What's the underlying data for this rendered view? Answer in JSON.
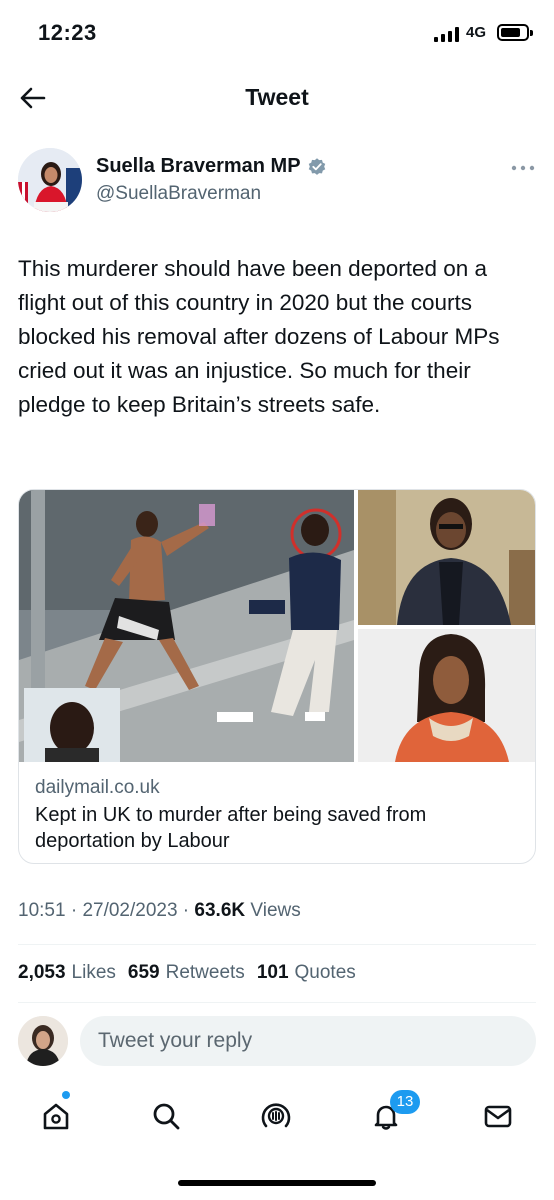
{
  "status_bar": {
    "time": "12:23",
    "network": "4G",
    "battery_level": 0.8
  },
  "header": {
    "title": "Tweet",
    "back_icon": "arrow-left-icon"
  },
  "tweet": {
    "author_name": "Suella Braverman MP",
    "author_handle": "@SuellaBraverman",
    "verified_icon": "verified-badge-icon",
    "text": "This murderer should have been deported on a flight out of this country in 2020 but the courts blocked his removal after dozens of Labour MPs cried out it was an injustice. So much for their pledge to keep Britain’s streets safe.",
    "card": {
      "domain": "dailymail.co.uk",
      "title": "Kept in UK to murder after being saved from deportation by Labour"
    },
    "time": "10:51",
    "date": "27/02/2023",
    "views_count": "63.6K",
    "views_label": "Views",
    "likes_count": "2,053",
    "likes_label": "Likes",
    "retweets_count": "659",
    "retweets_label": "Retweets",
    "quotes_count": "101",
    "quotes_label": "Quotes"
  },
  "reply": {
    "placeholder": "Tweet your reply"
  },
  "nav": {
    "items": [
      "home-icon",
      "search-icon",
      "spaces-icon",
      "notifications-icon",
      "messages-icon"
    ],
    "notification_count": "13"
  },
  "colors": {
    "accent": "#1d9bf0",
    "secondary_text": "#536471",
    "primary_text": "#0f1419"
  }
}
